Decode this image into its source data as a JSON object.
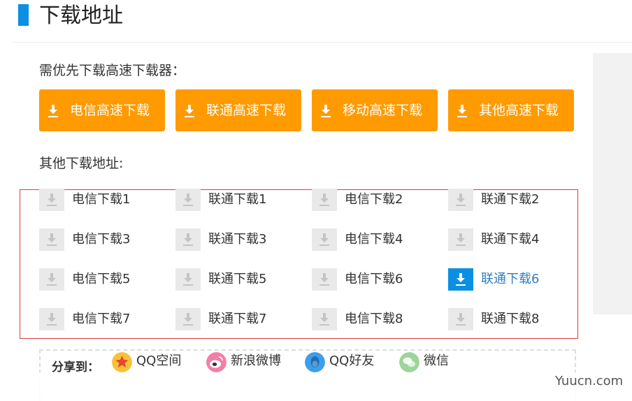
{
  "section": {
    "title": "下载地址",
    "accent_color": "#0a8fe3"
  },
  "highspeed": {
    "note": "需优先下载高速下载器：",
    "button_color": "#ff9a00",
    "buttons": [
      {
        "label": "电信高速下载",
        "icon": "download-icon"
      },
      {
        "label": "联通高速下载",
        "icon": "download-icon"
      },
      {
        "label": "移动高速下载",
        "icon": "download-icon"
      },
      {
        "label": "其他高速下载",
        "icon": "download-icon"
      }
    ]
  },
  "other": {
    "label": "其他下载地址:",
    "links": [
      "电信下载1",
      "联通下载1",
      "电信下载2",
      "联通下载2",
      "电信下载3",
      "联通下载3",
      "电信下载4",
      "联通下载4",
      "电信下载5",
      "联通下载5",
      "电信下载6",
      "联通下载6",
      "电信下载7",
      "联通下载7",
      "电信下载8",
      "联通下载8"
    ],
    "active_link": "联通下载6"
  },
  "share": {
    "label": "分享到：",
    "items": [
      {
        "label": "QQ空间",
        "icon": "qzone-star-icon",
        "color": "#f6c23a"
      },
      {
        "label": "新浪微博",
        "icon": "weibo-icon",
        "color": "#f47fa6"
      },
      {
        "label": "QQ好友",
        "icon": "qq-penguin-icon",
        "color": "#3d9fe8"
      },
      {
        "label": "微信",
        "icon": "wechat-icon",
        "color": "#9ed49a"
      }
    ]
  },
  "watermark": "Yuucn.com"
}
